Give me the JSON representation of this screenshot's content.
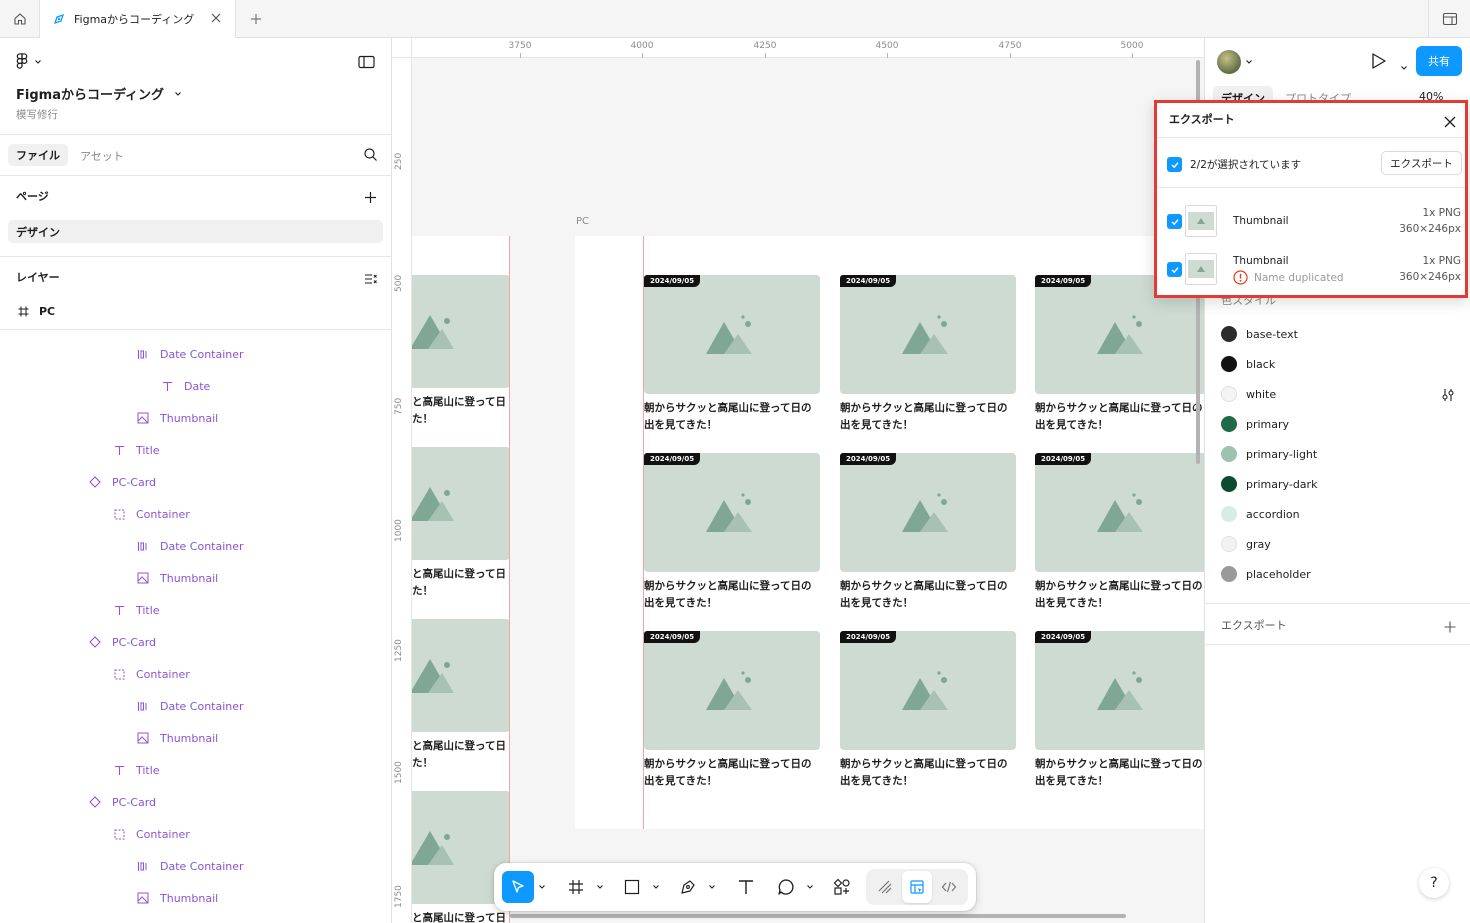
{
  "tab": {
    "title": "Figmaからコーディング"
  },
  "file": {
    "name": "Figmaからコーディング",
    "project": "模写修行"
  },
  "left_tabs": {
    "files": "ファイル",
    "assets": "アセット"
  },
  "pages": {
    "header": "ページ",
    "items": [
      "デザイン"
    ]
  },
  "layers": {
    "header": "レイヤー",
    "root": "PC",
    "items": [
      {
        "label": "Date Container",
        "type": "autolayout"
      },
      {
        "label": "Date",
        "type": "text"
      },
      {
        "label": "Thumbnail",
        "type": "image"
      },
      {
        "label": "Title",
        "type": "text"
      },
      {
        "label": "PC-Card",
        "type": "component"
      },
      {
        "label": "Container",
        "type": "frame"
      },
      {
        "label": "Date Container",
        "type": "autolayout"
      },
      {
        "label": "Thumbnail",
        "type": "image"
      },
      {
        "label": "Title",
        "type": "text"
      },
      {
        "label": "PC-Card",
        "type": "component"
      },
      {
        "label": "Container",
        "type": "frame"
      },
      {
        "label": "Date Container",
        "type": "autolayout"
      },
      {
        "label": "Thumbnail",
        "type": "image"
      },
      {
        "label": "Title",
        "type": "text"
      },
      {
        "label": "PC-Card",
        "type": "component"
      },
      {
        "label": "Container",
        "type": "frame"
      },
      {
        "label": "Date Container",
        "type": "autolayout"
      },
      {
        "label": "Thumbnail",
        "type": "image"
      }
    ]
  },
  "ruler": {
    "top": [
      "3750",
      "4000",
      "4250",
      "4500",
      "4750",
      "5000"
    ],
    "left": [
      "250",
      "500",
      "750",
      "1000",
      "1250",
      "1500",
      "1750"
    ]
  },
  "canvas": {
    "frame_label": "PC",
    "card_date": "2024/09/05",
    "card_title_line1": "朝からサクッと高尾山に登って日の",
    "card_title_line2": "出を見てきた！",
    "partial_line1": "と高尾山に登って日",
    "partial_line2": "た！"
  },
  "right": {
    "share": "共有",
    "tab_design": "デザイン",
    "tab_prototype": "プロトタイプ",
    "zoom": "40%",
    "color_styles_header": "色スタイル",
    "color_styles": [
      {
        "name": "base-text",
        "color": "#2c2c2c"
      },
      {
        "name": "black",
        "color": "#111111"
      },
      {
        "name": "white",
        "color": "#f4f4f4"
      },
      {
        "name": "primary",
        "color": "#1f6b47"
      },
      {
        "name": "primary-light",
        "color": "#9fc2ae"
      },
      {
        "name": "primary-dark",
        "color": "#0f4a30"
      },
      {
        "name": "accordion",
        "color": "#d7ece2"
      },
      {
        "name": "gray",
        "color": "#f2f2f2"
      },
      {
        "name": "placeholder",
        "color": "#9a9a9a"
      }
    ],
    "export_section": "エクスポート"
  },
  "export_popup": {
    "title": "エクスポート",
    "selected": "2/2が選択されています",
    "export_button": "エクスポート",
    "rows": [
      {
        "name": "Thumbnail",
        "scale_format": "1x PNG",
        "size": "360×246px",
        "warning": ""
      },
      {
        "name": "Thumbnail",
        "scale_format": "1x PNG",
        "size": "360×246px",
        "warning": "Name duplicated"
      }
    ]
  },
  "help": "?"
}
